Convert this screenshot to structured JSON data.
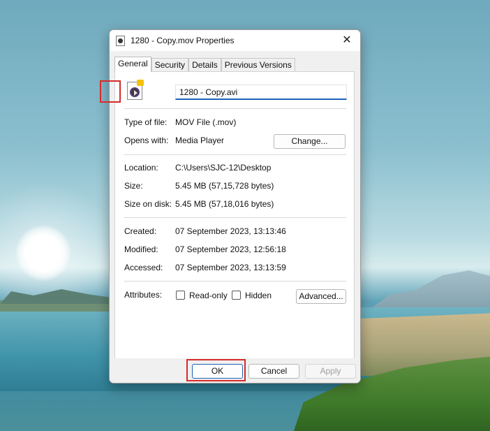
{
  "dialog": {
    "title": "1280 - Copy.mov Properties",
    "close_glyph": "✕"
  },
  "tabs": [
    {
      "label": "General",
      "active": true
    },
    {
      "label": "Security",
      "active": false
    },
    {
      "label": "Details",
      "active": false
    },
    {
      "label": "Previous Versions",
      "active": false
    }
  ],
  "general": {
    "file_name": "1280 - Copy.avi",
    "type_label": "Type of file:",
    "type_value": "MOV File (.mov)",
    "opens_label": "Opens with:",
    "opens_value": "Media Player",
    "change_button": "Change...",
    "location_label": "Location:",
    "location_value": "C:\\Users\\SJC-12\\Desktop",
    "size_label": "Size:",
    "size_value": "5.45 MB (57,15,728 bytes)",
    "size_on_disk_label": "Size on disk:",
    "size_on_disk_value": "5.45 MB (57,18,016 bytes)",
    "created_label": "Created:",
    "created_value": "07 September 2023, 13:13:46",
    "modified_label": "Modified:",
    "modified_value": "07 September 2023, 12:56:18",
    "accessed_label": "Accessed:",
    "accessed_value": "07 September 2023, 13:13:59",
    "attributes_label": "Attributes:",
    "readonly_label": "Read-only",
    "hidden_label": "Hidden",
    "advanced_button": "Advanced..."
  },
  "footer": {
    "ok": "OK",
    "cancel": "Cancel",
    "apply": "Apply"
  },
  "colors": {
    "accent": "#1f63b8",
    "highlight": "#d62b2b"
  }
}
